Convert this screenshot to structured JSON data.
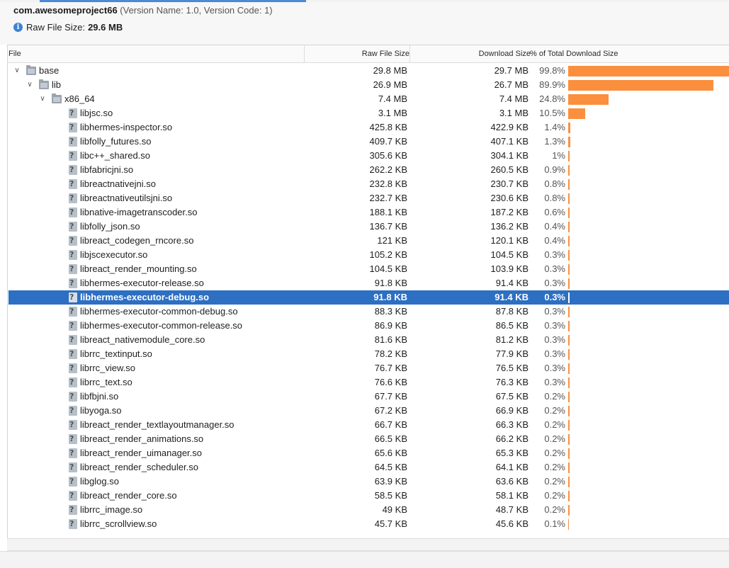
{
  "header": {
    "package_name": "com.awesomeproject66",
    "version_info": " (Version Name: 1.0, Version Code: 1)",
    "raw_file_size_label": "Raw File Size:",
    "raw_file_size_value": "29.6 MB"
  },
  "columns": {
    "file": "File",
    "raw": "Raw File Size",
    "download": "Download Size",
    "percent": "% of Total Download Size"
  },
  "colors": {
    "bar": "#fb8f3e",
    "selection": "#2d6fc2"
  },
  "rows": [
    {
      "name": "base",
      "type": "folder",
      "depth": 0,
      "expanded": true,
      "raw": "29.8 MB",
      "dl": "29.7 MB",
      "pct": "99.8%",
      "frac": 0.998
    },
    {
      "name": "lib",
      "type": "folder",
      "depth": 1,
      "expanded": true,
      "raw": "26.9 MB",
      "dl": "26.7 MB",
      "pct": "89.9%",
      "frac": 0.899
    },
    {
      "name": "x86_64",
      "type": "folder",
      "depth": 2,
      "expanded": true,
      "raw": "7.4 MB",
      "dl": "7.4 MB",
      "pct": "24.8%",
      "frac": 0.248
    },
    {
      "name": "libjsc.so",
      "type": "file",
      "depth": 3,
      "raw": "3.1 MB",
      "dl": "3.1 MB",
      "pct": "10.5%",
      "frac": 0.105
    },
    {
      "name": "libhermes-inspector.so",
      "type": "file",
      "depth": 3,
      "raw": "425.8 KB",
      "dl": "422.9 KB",
      "pct": "1.4%",
      "frac": 0.014
    },
    {
      "name": "libfolly_futures.so",
      "type": "file",
      "depth": 3,
      "raw": "409.7 KB",
      "dl": "407.1 KB",
      "pct": "1.3%",
      "frac": 0.013
    },
    {
      "name": "libc++_shared.so",
      "type": "file",
      "depth": 3,
      "raw": "305.6 KB",
      "dl": "304.1 KB",
      "pct": "1%",
      "frac": 0.01
    },
    {
      "name": "libfabricjni.so",
      "type": "file",
      "depth": 3,
      "raw": "262.2 KB",
      "dl": "260.5 KB",
      "pct": "0.9%",
      "frac": 0.009
    },
    {
      "name": "libreactnativejni.so",
      "type": "file",
      "depth": 3,
      "raw": "232.8 KB",
      "dl": "230.7 KB",
      "pct": "0.8%",
      "frac": 0.008
    },
    {
      "name": "libreactnativeutilsjni.so",
      "type": "file",
      "depth": 3,
      "raw": "232.7 KB",
      "dl": "230.6 KB",
      "pct": "0.8%",
      "frac": 0.008
    },
    {
      "name": "libnative-imagetranscoder.so",
      "type": "file",
      "depth": 3,
      "raw": "188.1 KB",
      "dl": "187.2 KB",
      "pct": "0.6%",
      "frac": 0.006
    },
    {
      "name": "libfolly_json.so",
      "type": "file",
      "depth": 3,
      "raw": "136.7 KB",
      "dl": "136.2 KB",
      "pct": "0.4%",
      "frac": 0.004
    },
    {
      "name": "libreact_codegen_rncore.so",
      "type": "file",
      "depth": 3,
      "raw": "121 KB",
      "dl": "120.1 KB",
      "pct": "0.4%",
      "frac": 0.004
    },
    {
      "name": "libjscexecutor.so",
      "type": "file",
      "depth": 3,
      "raw": "105.2 KB",
      "dl": "104.5 KB",
      "pct": "0.3%",
      "frac": 0.003
    },
    {
      "name": "libreact_render_mounting.so",
      "type": "file",
      "depth": 3,
      "raw": "104.5 KB",
      "dl": "103.9 KB",
      "pct": "0.3%",
      "frac": 0.003
    },
    {
      "name": "libhermes-executor-release.so",
      "type": "file",
      "depth": 3,
      "raw": "91.8 KB",
      "dl": "91.4 KB",
      "pct": "0.3%",
      "frac": 0.003
    },
    {
      "name": "libhermes-executor-debug.so",
      "type": "file",
      "depth": 3,
      "raw": "91.8 KB",
      "dl": "91.4 KB",
      "pct": "0.3%",
      "frac": 0.003,
      "selected": true
    },
    {
      "name": "libhermes-executor-common-debug.so",
      "type": "file",
      "depth": 3,
      "raw": "88.3 KB",
      "dl": "87.8 KB",
      "pct": "0.3%",
      "frac": 0.003
    },
    {
      "name": "libhermes-executor-common-release.so",
      "type": "file",
      "depth": 3,
      "raw": "86.9 KB",
      "dl": "86.5 KB",
      "pct": "0.3%",
      "frac": 0.003
    },
    {
      "name": "libreact_nativemodule_core.so",
      "type": "file",
      "depth": 3,
      "raw": "81.6 KB",
      "dl": "81.2 KB",
      "pct": "0.3%",
      "frac": 0.003
    },
    {
      "name": "librrc_textinput.so",
      "type": "file",
      "depth": 3,
      "raw": "78.2 KB",
      "dl": "77.9 KB",
      "pct": "0.3%",
      "frac": 0.003
    },
    {
      "name": "librrc_view.so",
      "type": "file",
      "depth": 3,
      "raw": "76.7 KB",
      "dl": "76.5 KB",
      "pct": "0.3%",
      "frac": 0.003
    },
    {
      "name": "librrc_text.so",
      "type": "file",
      "depth": 3,
      "raw": "76.6 KB",
      "dl": "76.3 KB",
      "pct": "0.3%",
      "frac": 0.003
    },
    {
      "name": "libfbjni.so",
      "type": "file",
      "depth": 3,
      "raw": "67.7 KB",
      "dl": "67.5 KB",
      "pct": "0.2%",
      "frac": 0.002
    },
    {
      "name": "libyoga.so",
      "type": "file",
      "depth": 3,
      "raw": "67.2 KB",
      "dl": "66.9 KB",
      "pct": "0.2%",
      "frac": 0.002
    },
    {
      "name": "libreact_render_textlayoutmanager.so",
      "type": "file",
      "depth": 3,
      "raw": "66.7 KB",
      "dl": "66.3 KB",
      "pct": "0.2%",
      "frac": 0.002
    },
    {
      "name": "libreact_render_animations.so",
      "type": "file",
      "depth": 3,
      "raw": "66.5 KB",
      "dl": "66.2 KB",
      "pct": "0.2%",
      "frac": 0.002
    },
    {
      "name": "libreact_render_uimanager.so",
      "type": "file",
      "depth": 3,
      "raw": "65.6 KB",
      "dl": "65.3 KB",
      "pct": "0.2%",
      "frac": 0.002
    },
    {
      "name": "libreact_render_scheduler.so",
      "type": "file",
      "depth": 3,
      "raw": "64.5 KB",
      "dl": "64.1 KB",
      "pct": "0.2%",
      "frac": 0.002
    },
    {
      "name": "libglog.so",
      "type": "file",
      "depth": 3,
      "raw": "63.9 KB",
      "dl": "63.6 KB",
      "pct": "0.2%",
      "frac": 0.002
    },
    {
      "name": "libreact_render_core.so",
      "type": "file",
      "depth": 3,
      "raw": "58.5 KB",
      "dl": "58.1 KB",
      "pct": "0.2%",
      "frac": 0.002
    },
    {
      "name": "librrc_image.so",
      "type": "file",
      "depth": 3,
      "raw": "49 KB",
      "dl": "48.7 KB",
      "pct": "0.2%",
      "frac": 0.002
    },
    {
      "name": "librrc_scrollview.so",
      "type": "file",
      "depth": 3,
      "raw": "45.7 KB",
      "dl": "45.6 KB",
      "pct": "0.1%",
      "frac": 0.001
    }
  ]
}
